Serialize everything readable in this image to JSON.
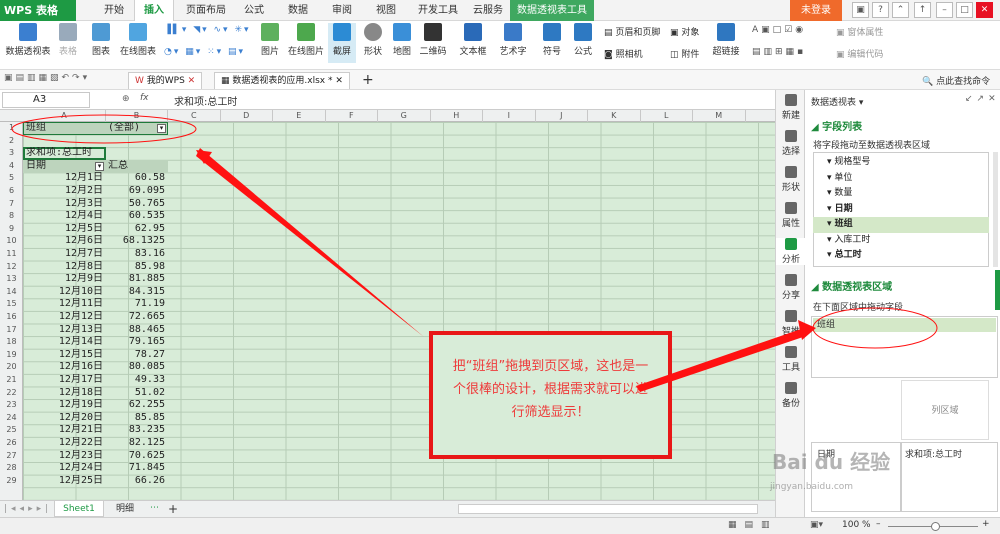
{
  "app": {
    "logo": "WPS 表格",
    "login": "未登录"
  },
  "tabs": [
    "开始",
    "插入",
    "页面布局",
    "公式",
    "数据",
    "审阅",
    "视图",
    "开发工具",
    "云服务",
    "数据透视表工具"
  ],
  "ribbon": {
    "pivot": "数据透视表",
    "table": "表格",
    "chart": "图表",
    "online_chart": "在线图表",
    "picture": "图片",
    "online_picture": "在线图片",
    "screenshot": "截屏",
    "shape": "形状",
    "map": "地图",
    "qrcode": "二维码",
    "textbox": "文本框",
    "wordart": "艺术字",
    "symbol": "符号",
    "formula": "公式",
    "header_footer": "页眉和页脚",
    "object": "对象",
    "camera": "照相机",
    "attachment": "附件",
    "hyperlink": "超链接",
    "form_props": "窗体属性",
    "edit_code": "编辑代码"
  },
  "doc_tabs": {
    "home": "我的WPS",
    "file": "数据透视表的应用.xlsx *"
  },
  "search_cmd": "点此查找命令",
  "name_box": "A3",
  "fx": "fx",
  "formula": "求和项:总工时",
  "columns": [
    "A",
    "B",
    "C",
    "D",
    "E",
    "F",
    "G",
    "H",
    "I",
    "J",
    "K",
    "L",
    "M"
  ],
  "rows": [
    "1",
    "2",
    "3",
    "4",
    "5",
    "6",
    "7",
    "8",
    "9",
    "10",
    "11",
    "12",
    "13",
    "14",
    "15",
    "16",
    "17",
    "18",
    "19",
    "20",
    "21",
    "22",
    "23",
    "24",
    "25",
    "26",
    "27",
    "28",
    "29"
  ],
  "cells": {
    "a1": "班组",
    "b1": "(全部)",
    "a3": "求和项:总工时",
    "a4": "日期",
    "b4": "汇总"
  },
  "data_rows": [
    [
      "12月1日",
      "60.58"
    ],
    [
      "12月2日",
      "69.095"
    ],
    [
      "12月3日",
      "50.765"
    ],
    [
      "12月4日",
      "60.535"
    ],
    [
      "12月5日",
      "62.95"
    ],
    [
      "12月6日",
      "68.1325"
    ],
    [
      "12月7日",
      "83.16"
    ],
    [
      "12月8日",
      "85.98"
    ],
    [
      "12月9日",
      "81.885"
    ],
    [
      "12月10日",
      "84.315"
    ],
    [
      "12月11日",
      "71.19"
    ],
    [
      "12月12日",
      "72.665"
    ],
    [
      "12月13日",
      "88.465"
    ],
    [
      "12月14日",
      "79.165"
    ],
    [
      "12月15日",
      "78.27"
    ],
    [
      "12月16日",
      "80.085"
    ],
    [
      "12月17日",
      "49.33"
    ],
    [
      "12月18日",
      "51.02"
    ],
    [
      "12月19日",
      "62.255"
    ],
    [
      "12月20日",
      "85.85"
    ],
    [
      "12月21日",
      "83.235"
    ],
    [
      "12月22日",
      "82.125"
    ],
    [
      "12月23日",
      "70.625"
    ],
    [
      "12月24日",
      "71.845"
    ],
    [
      "12月25日",
      "66.26"
    ]
  ],
  "sheets": [
    "Sheet1",
    "明细"
  ],
  "side_tabs": [
    "新建",
    "选择",
    "形状",
    "属性",
    "分析",
    "分享",
    "智推",
    "工具",
    "备份"
  ],
  "pane": {
    "title": "数据透视表",
    "section1": "字段列表",
    "hint1": "将字段拖动至数据透视表区域",
    "fields": [
      "规格型号",
      "单位",
      "数量",
      "日期",
      "班组",
      "入库工时",
      "总工时"
    ],
    "section2": "数据透视表区域",
    "hint2": "在下面区域中拖动字段",
    "page_item": "班组",
    "col_area": "列区域",
    "row_item": "日期",
    "value_item": "求和项:总工时"
  },
  "annotation": "把“班组”拖拽到页区域，这也是一个很棒的设计，根据需求就可以进行筛选显示！",
  "zoom": "100 %",
  "watermark": "Bai du 经验",
  "watermark_url": "jingyan.baidu.com"
}
